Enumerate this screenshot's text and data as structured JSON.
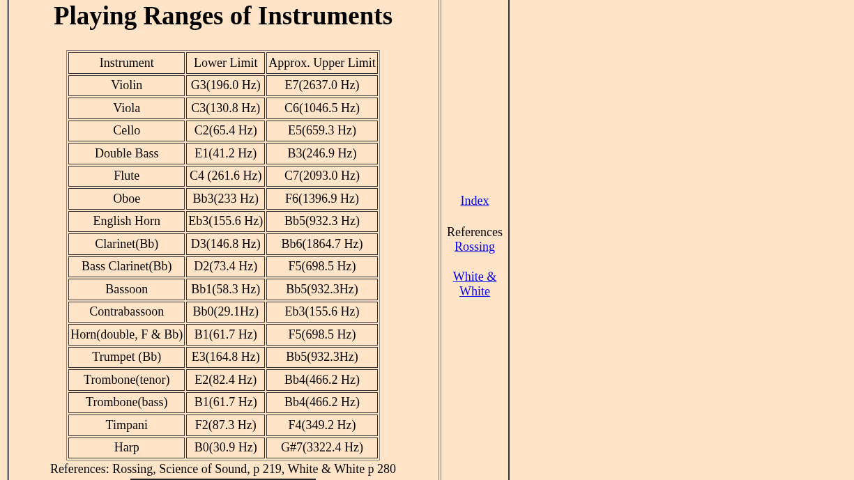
{
  "title": "Playing Ranges of Instruments",
  "table": {
    "columns": [
      "Instrument",
      "Lower Limit",
      "Approx. Upper Limit"
    ],
    "rows": [
      [
        "Violin",
        "G3(196.0 Hz)",
        "E7(2637.0 Hz)"
      ],
      [
        "Viola",
        "C3(130.8 Hz)",
        "C6(1046.5 Hz)"
      ],
      [
        "Cello",
        "C2(65.4 Hz)",
        "E5(659.3 Hz)"
      ],
      [
        "Double Bass",
        "E1(41.2 Hz)",
        "B3(246.9 Hz)"
      ],
      [
        "Flute",
        "C4 (261.6 Hz)",
        "C7(2093.0 Hz)"
      ],
      [
        "Oboe",
        "Bb3(233 Hz)",
        "F6(1396.9 Hz)"
      ],
      [
        "English Horn",
        "Eb3(155.6 Hz)",
        "Bb5(932.3 Hz)"
      ],
      [
        "Clarinet(Bb)",
        "D3(146.8 Hz)",
        "Bb6(1864.7 Hz)"
      ],
      [
        "Bass Clarinet(Bb)",
        "D2(73.4 Hz)",
        "F5(698.5 Hz)"
      ],
      [
        "Bassoon",
        "Bb1(58.3 Hz)",
        "Bb5(932.3Hz)"
      ],
      [
        "Contrabassoon",
        "Bb0(29.1Hz)",
        "Eb3(155.6 Hz)"
      ],
      [
        "Horn(double, F & Bb)",
        "B1(61.7 Hz)",
        "F5(698.5 Hz)"
      ],
      [
        "Trumpet (Bb)",
        "E3(164.8 Hz)",
        "Bb5(932.3Hz)"
      ],
      [
        "Trombone(tenor)",
        "E2(82.4 Hz)",
        "Bb4(466.2 Hz)"
      ],
      [
        "Trombone(bass)",
        "B1(61.7 Hz)",
        "Bb4(466.2 Hz)"
      ],
      [
        "Timpani",
        "F2(87.3 Hz)",
        "F4(349.2 Hz)"
      ],
      [
        "Harp",
        "B0(30.9 Hz)",
        "G#7(3322.4 Hz)"
      ]
    ]
  },
  "caption": "References: Rossing, Science of Sound, p 219, White & White p 280",
  "sidebar": {
    "index_link": "Index",
    "references_label": "References",
    "links": [
      "Rossing",
      "White & White"
    ]
  }
}
